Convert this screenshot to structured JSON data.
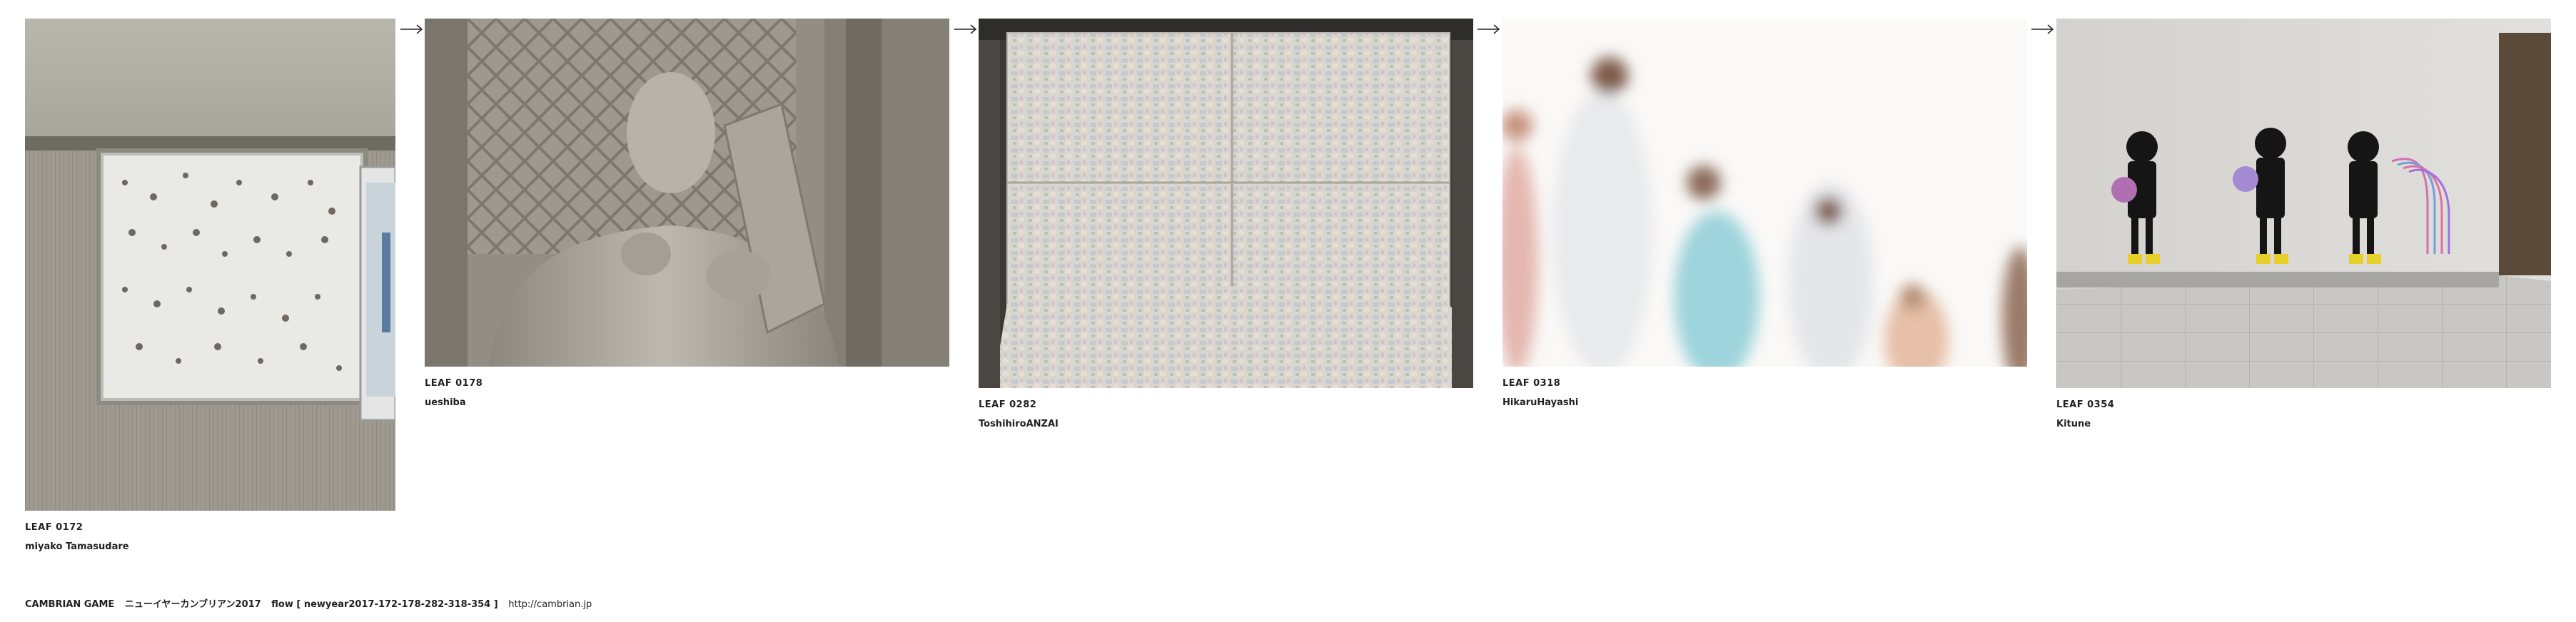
{
  "leaves": [
    {
      "number": "LEAF 0172",
      "author": "miyako Tamasudare",
      "image_description": "wall-panel-photo"
    },
    {
      "number": "LEAF 0178",
      "author": "ueshiba",
      "image_description": "statue-photo"
    },
    {
      "number": "LEAF 0282",
      "author": "ToshihiroANZAI",
      "image_description": "paper-bales-photo"
    },
    {
      "number": "LEAF 0318",
      "author": "HikaruHayashi",
      "image_description": "blurred-people-photo"
    },
    {
      "number": "LEAF 0354",
      "author": "Kitune",
      "image_description": "stencil-girls-photo"
    }
  ],
  "arrows": [
    "arrow-icon",
    "arrow-icon",
    "arrow-icon",
    "arrow-icon"
  ],
  "footer": {
    "title": "CAMBRIAN GAME",
    "subtitle": "ニューイヤーカンブリアン2017",
    "flow": "flow [ newyear2017-172-178-282-318-354 ]",
    "url": "http://cambrian.jp"
  },
  "colors": {
    "text": "#222222",
    "background": "#ffffff"
  }
}
